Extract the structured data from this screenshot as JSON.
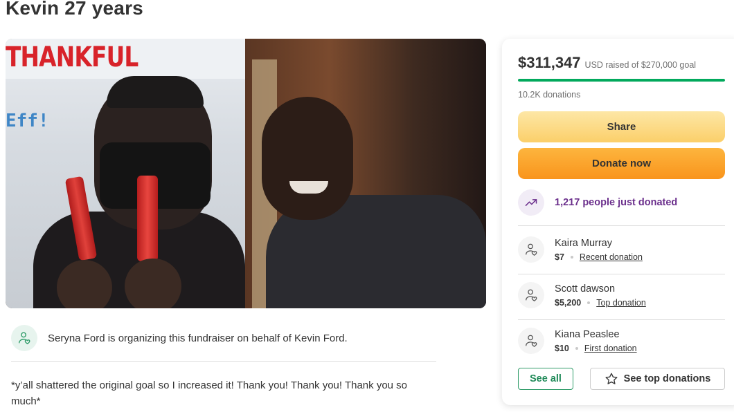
{
  "page": {
    "title": "Kevin 27 years"
  },
  "hero": {
    "banner_text": "THANKFUL",
    "sign_text": "Eff!"
  },
  "organizer": {
    "text": "Seryna Ford is organizing this fundraiser on behalf of Kevin Ford.",
    "icon": "person-heart-icon"
  },
  "story": {
    "text": "*y’all shattered the original goal so I increased it! Thank you! Thank you! Thank you so much*"
  },
  "donation_card": {
    "amount_raised": "$311,347",
    "goal_text": "USD raised of $270,000 goal",
    "progress_fraction": 1.0,
    "donation_count": "10.2K donations",
    "share_label": "Share",
    "donate_label": "Donate now",
    "trend_text": "1,217 people just donated",
    "trend_icon": "trending-up-icon",
    "donors": [
      {
        "name": "Kaira Murray",
        "amount": "$7",
        "type": "Recent donation"
      },
      {
        "name": "Scott dawson",
        "amount": "$5,200",
        "type": "Top donation"
      },
      {
        "name": "Kiana Peaslee",
        "amount": "$10",
        "type": "First donation"
      }
    ],
    "see_all_label": "See all",
    "see_top_label": "See top donations",
    "colors": {
      "progress": "#02a95c",
      "trend_text": "#6b2f8c",
      "donate": "#f9941c",
      "share": "#fbcf6a"
    }
  }
}
